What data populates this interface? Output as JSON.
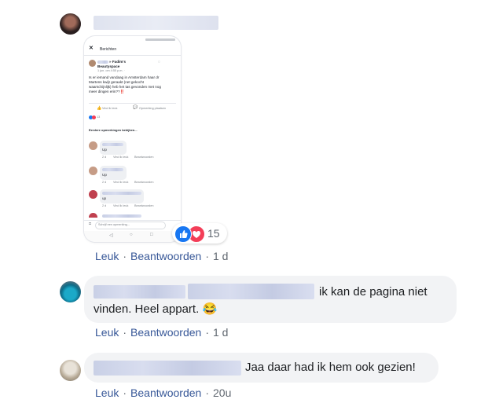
{
  "comment1": {
    "reaction_count": "15",
    "actions": {
      "like": "Leuk",
      "reply": "Beantwoorden",
      "time": "1 d"
    },
    "screenshot": {
      "header_title": "Berichten",
      "post": {
        "author_suffix": "» Fadim's",
        "author_page": "Beautyspace",
        "meta": "1 jun. om 4:55 p.m. ·",
        "text": "Is er iemand vandaag in Amsterdam haar dr Martens kwijt geraakt (net gekocht waarschijnlijk) heb het tas gevonden met nog meer dingen erin??‼️"
      },
      "like_button": "Vind ik leuk",
      "comment_button": "Opmerking plaatsen",
      "reactions_count": "13",
      "view_more": "Eerdere opmerkingen bekijken...",
      "replies": [
        {
          "text": "Up",
          "time": "2 d",
          "like": "Vind ik leuk",
          "reply": "Beantwoorden"
        },
        {
          "text": "Up",
          "time": "2 d",
          "like": "Vind ik leuk",
          "reply": "Beantwoorden"
        },
        {
          "text": "up",
          "time": "2 d",
          "like": "Vind ik leuk",
          "reply": "Beantwoorden"
        }
      ],
      "input_placeholder": "Schrijf een opmerking..."
    }
  },
  "comment2": {
    "text_line1": "ik kan de pagina niet",
    "text_line2": "vinden. Heel appart.",
    "emoji": "😂",
    "actions": {
      "like": "Leuk",
      "reply": "Beantwoorden",
      "time": "1 d"
    }
  },
  "comment3": {
    "text": "Jaa daar had ik hem ook gezien!",
    "actions": {
      "like": "Leuk",
      "reply": "Beantwoorden",
      "time": "20u"
    }
  },
  "colors": {
    "link": "#385898",
    "like_blue": "#1877f2",
    "love_red": "#f33e58",
    "bubble": "#f2f3f5"
  }
}
